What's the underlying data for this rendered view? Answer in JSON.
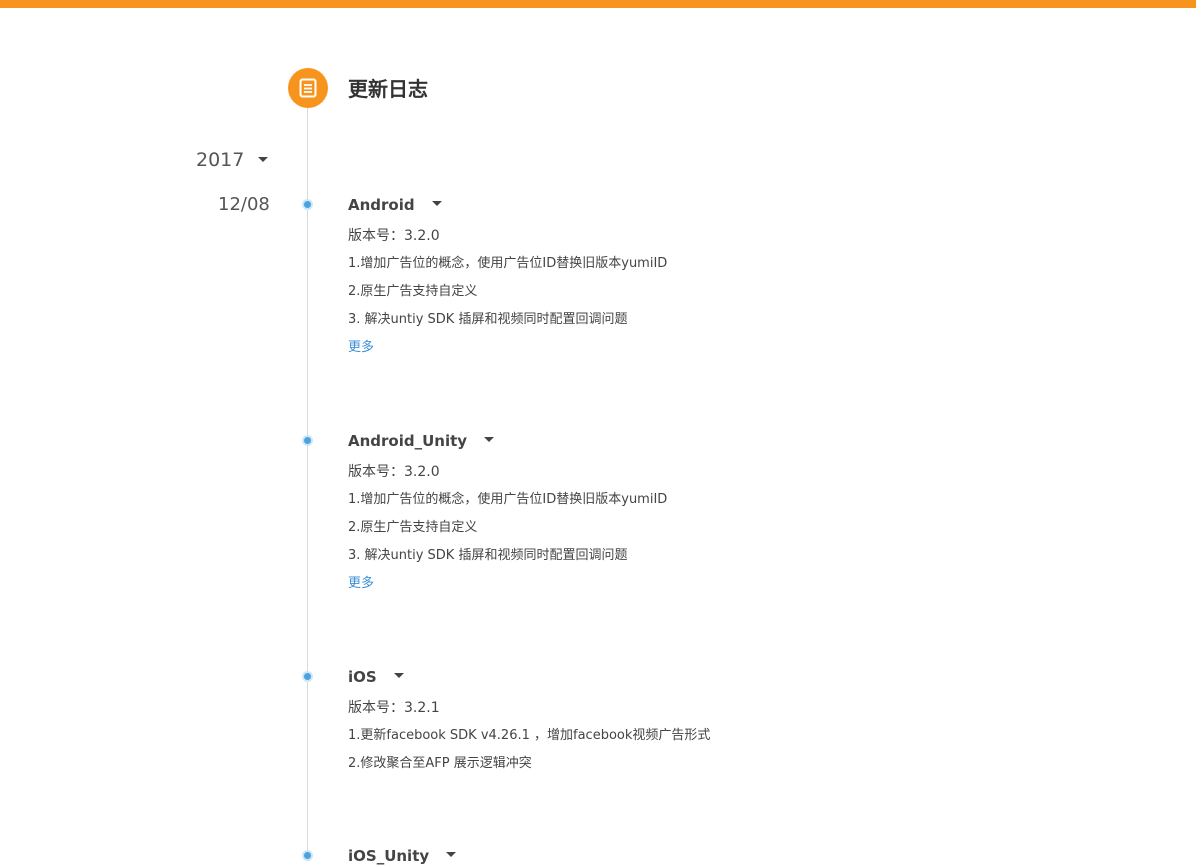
{
  "header": {
    "title": "更新日志",
    "accent_color": "#f7941e",
    "icon": "document-icon"
  },
  "timeline": {
    "year": "2017",
    "date": "12/08",
    "entries": [
      {
        "title": "Android",
        "version": "版本号：3.2.0",
        "notes": [
          "1.增加广告位的概念，使用广告位ID替换旧版本yumiID",
          "2.原生广告支持自定义",
          "3. 解决untiy SDK 插屏和视频同时配置回调问题"
        ],
        "more": "更多"
      },
      {
        "title": "Android_Unity",
        "version": "版本号：3.2.0",
        "notes": [
          "1.增加广告位的概念，使用广告位ID替换旧版本yumiID",
          "2.原生广告支持自定义",
          "3. 解决untiy SDK 插屏和视频同时配置回调问题"
        ],
        "more": "更多"
      },
      {
        "title": "iOS",
        "version": "版本号：3.2.1",
        "notes": [
          "1.更新facebook SDK v4.26.1 ，增加facebook视频广告形式",
          "2.修改聚合至AFP 展示逻辑冲突"
        ]
      },
      {
        "title": "iOS_Unity"
      }
    ]
  }
}
